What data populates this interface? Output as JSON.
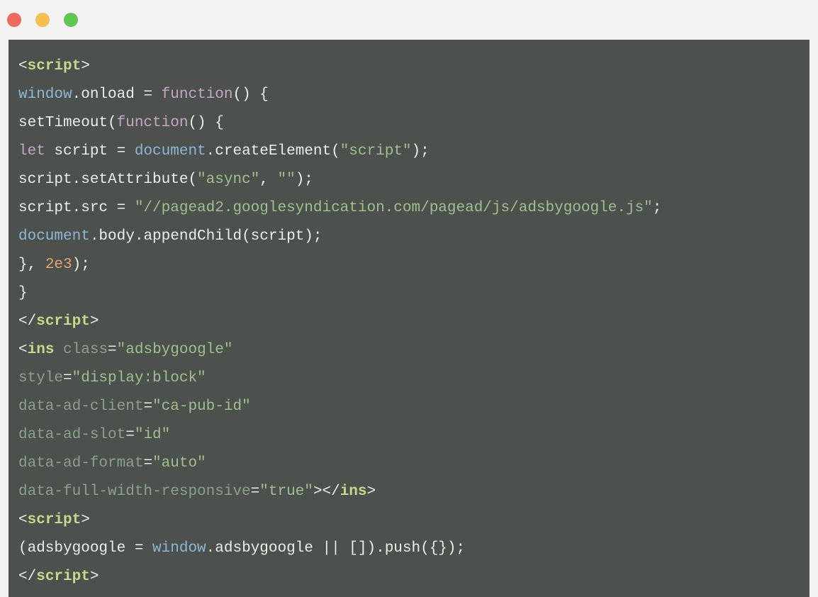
{
  "window": {
    "buttons": [
      "close",
      "minimize",
      "zoom"
    ]
  },
  "code": {
    "lines": [
      [
        {
          "t": "<",
          "c": "punct"
        },
        {
          "t": "script",
          "c": "tag"
        },
        {
          "t": ">",
          "c": "punct"
        }
      ],
      [
        {
          "t": "window",
          "c": "window"
        },
        {
          "t": ".onload = ",
          "c": "default"
        },
        {
          "t": "function",
          "c": "func"
        },
        {
          "t": "() {",
          "c": "default"
        }
      ],
      [
        {
          "t": "setTimeout(",
          "c": "default"
        },
        {
          "t": "function",
          "c": "func"
        },
        {
          "t": "() {",
          "c": "default"
        }
      ],
      [
        {
          "t": "let",
          "c": "keyword"
        },
        {
          "t": " script = ",
          "c": "default"
        },
        {
          "t": "document",
          "c": "document"
        },
        {
          "t": ".createElement(",
          "c": "default"
        },
        {
          "t": "\"script\"",
          "c": "string"
        },
        {
          "t": ");",
          "c": "default"
        }
      ],
      [
        {
          "t": "script.setAttribute(",
          "c": "default"
        },
        {
          "t": "\"async\"",
          "c": "string"
        },
        {
          "t": ", ",
          "c": "default"
        },
        {
          "t": "\"\"",
          "c": "string"
        },
        {
          "t": ");",
          "c": "default"
        }
      ],
      [
        {
          "t": "script.src = ",
          "c": "default"
        },
        {
          "t": "\"//pagead2.googlesyndication.com/pagead/js/adsbygoogle.js\"",
          "c": "string"
        },
        {
          "t": ";",
          "c": "default"
        }
      ],
      [
        {
          "t": "document",
          "c": "document"
        },
        {
          "t": ".body.appendChild(script);",
          "c": "default"
        }
      ],
      [
        {
          "t": "}, ",
          "c": "default"
        },
        {
          "t": "2e3",
          "c": "number"
        },
        {
          "t": ");",
          "c": "default"
        }
      ],
      [
        {
          "t": "}",
          "c": "default"
        }
      ],
      [
        {
          "t": "</",
          "c": "punct"
        },
        {
          "t": "script",
          "c": "tag"
        },
        {
          "t": ">",
          "c": "punct"
        }
      ],
      [
        {
          "t": "<",
          "c": "punct"
        },
        {
          "t": "ins",
          "c": "tag"
        },
        {
          "t": " ",
          "c": "default"
        },
        {
          "t": "class",
          "c": "attr"
        },
        {
          "t": "=",
          "c": "default"
        },
        {
          "t": "\"adsbygoogle\"",
          "c": "string"
        }
      ],
      [
        {
          "t": "style",
          "c": "attr"
        },
        {
          "t": "=",
          "c": "default"
        },
        {
          "t": "\"display:block\"",
          "c": "string"
        }
      ],
      [
        {
          "t": "data-ad-client",
          "c": "attr"
        },
        {
          "t": "=",
          "c": "default"
        },
        {
          "t": "\"ca-pub-id\"",
          "c": "string"
        }
      ],
      [
        {
          "t": "data-ad-slot",
          "c": "attr"
        },
        {
          "t": "=",
          "c": "default"
        },
        {
          "t": "\"id\"",
          "c": "string"
        }
      ],
      [
        {
          "t": "data-ad-format",
          "c": "attr"
        },
        {
          "t": "=",
          "c": "default"
        },
        {
          "t": "\"auto\"",
          "c": "string"
        }
      ],
      [
        {
          "t": "data-full-width-responsive",
          "c": "attr"
        },
        {
          "t": "=",
          "c": "default"
        },
        {
          "t": "\"true\"",
          "c": "string"
        },
        {
          "t": "></",
          "c": "punct"
        },
        {
          "t": "ins",
          "c": "tag"
        },
        {
          "t": ">",
          "c": "punct"
        }
      ],
      [
        {
          "t": "<",
          "c": "punct"
        },
        {
          "t": "script",
          "c": "tag"
        },
        {
          "t": ">",
          "c": "punct"
        }
      ],
      [
        {
          "t": "(adsbygoogle = ",
          "c": "default"
        },
        {
          "t": "window",
          "c": "window"
        },
        {
          "t": ".adsbygoogle || []).push({});",
          "c": "default"
        }
      ],
      [
        {
          "t": "</",
          "c": "punct"
        },
        {
          "t": "script",
          "c": "tag"
        },
        {
          "t": ">",
          "c": "punct"
        }
      ]
    ]
  }
}
